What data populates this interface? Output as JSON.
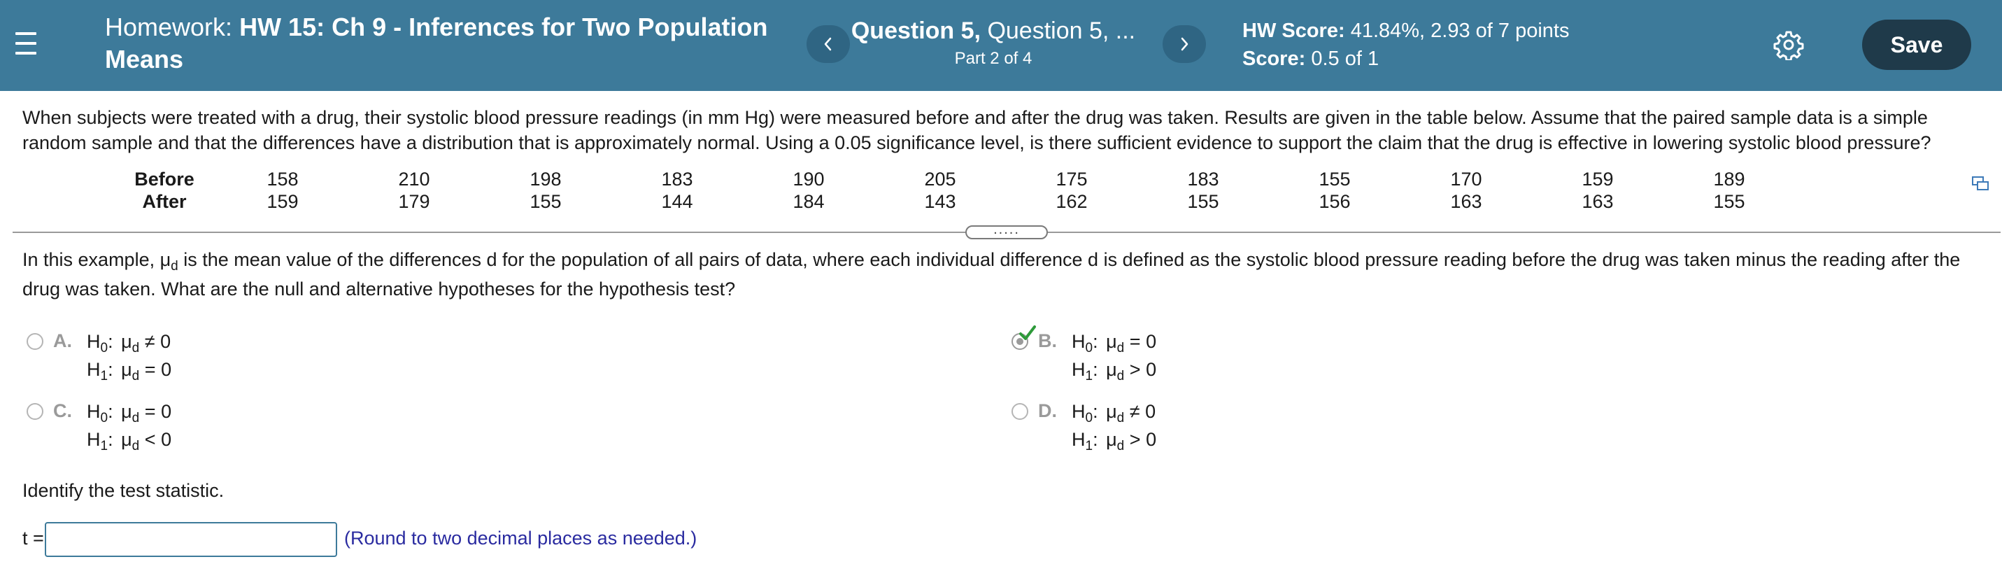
{
  "header": {
    "homework_prefix": "Homework:",
    "homework_name": "HW 15: Ch 9 - Inferences for Two Population Means",
    "prev_icon": "chevron-left-icon",
    "next_icon": "chevron-right-icon",
    "question_bold": "Question 5,",
    "question_rest": "Question 5, ...",
    "part": "Part 2 of 4",
    "hw_score_label": "HW Score:",
    "hw_score_value": "41.84%, 2.93 of 7 points",
    "score_label": "Score:",
    "score_value": "0.5 of 1",
    "settings_icon": "gear-icon",
    "save_label": "Save",
    "bg_color": "#3d7a9a"
  },
  "problem": {
    "text": "When subjects were treated with a drug, their systolic blood pressure readings (in mm Hg) were measured before and after the drug was taken. Results are given in the table below. Assume that the paired sample data is a simple random sample and that the differences have a distribution that is approximately normal. Using a 0.05 significance level, is there sufficient evidence to support the claim that the drug is effective in lowering systolic blood pressure?",
    "table": {
      "before_label": "Before",
      "after_label": "After",
      "before": [
        "158",
        "210",
        "198",
        "183",
        "190",
        "205",
        "175",
        "183",
        "155",
        "170",
        "159",
        "189"
      ],
      "after": [
        "159",
        "179",
        "155",
        "144",
        "184",
        "143",
        "162",
        "155",
        "156",
        "163",
        "163",
        "155"
      ]
    },
    "copy_icon": "copy-data-icon"
  },
  "question": {
    "part1": "In this example, ",
    "mu": "μ",
    "sub_d": "d",
    "part2": " is the mean value of the differences d for the population of all pairs of data, where each individual difference d is defined as the systolic blood pressure reading before the drug was taken minus the reading after the drug was taken. What are the null and alternative hypotheses for the hypothesis test?"
  },
  "options": [
    {
      "letter": "A.",
      "h0_op": "≠",
      "h0_val": "0",
      "h1_op": "=",
      "h1_val": "0",
      "selected": false
    },
    {
      "letter": "B.",
      "h0_op": "=",
      "h0_val": "0",
      "h1_op": ">",
      "h1_val": "0",
      "selected": true
    },
    {
      "letter": "C.",
      "h0_op": "=",
      "h0_val": "0",
      "h1_op": "<",
      "h1_val": "0",
      "selected": false
    },
    {
      "letter": "D.",
      "h0_op": "≠",
      "h0_val": "0",
      "h1_op": ">",
      "h1_val": "0",
      "selected": false
    }
  ],
  "hyp": {
    "H": "H",
    "sub0": "0",
    "sub1": "1",
    "colon": ":",
    "mu": "μ",
    "sub_d": "d"
  },
  "answer": {
    "identify": "Identify the test statistic.",
    "t_label": "t =",
    "t_value": "",
    "hint": "(Round to two decimal places as needed.)"
  },
  "correct_color": "#2e9a3a"
}
